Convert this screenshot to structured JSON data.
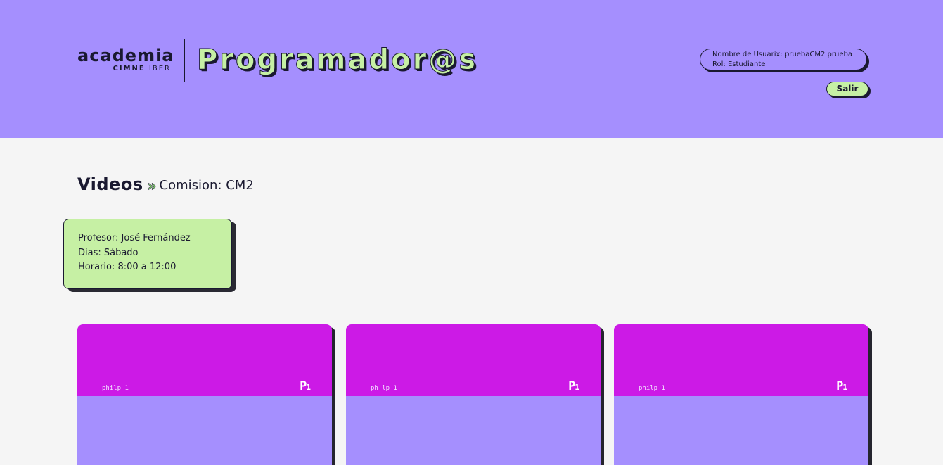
{
  "header": {
    "logo": {
      "main": "academia",
      "sub_a": "CIMNE",
      "sub_b": "IBER"
    },
    "brand": "Programador@s",
    "user": {
      "name_line": "Nombre de Usuarix: pruebaCM2 prueba",
      "role_line": "Rol: Estudiante"
    },
    "logout_label": "Salir"
  },
  "page": {
    "title": "Videos",
    "separator": "»",
    "subtitle": "Comision: CM2"
  },
  "info": {
    "professor": "Profesor: José Fernández",
    "days": "Dias: Sábado",
    "schedule": "Horario: 8:00 a 12:00"
  },
  "videos": [
    {
      "caption": "philp 1",
      "mark": "P",
      "mark_num": "1"
    },
    {
      "caption": "ph lp 1",
      "mark": "P",
      "mark_num": "1"
    },
    {
      "caption": "philp 1",
      "mark": "P",
      "mark_num": "1"
    }
  ],
  "colors": {
    "header_bg": "#a58ffe",
    "accent_green": "#c6f0a4",
    "video_thumb": "#cc1ae6",
    "ink": "#1a1930"
  }
}
